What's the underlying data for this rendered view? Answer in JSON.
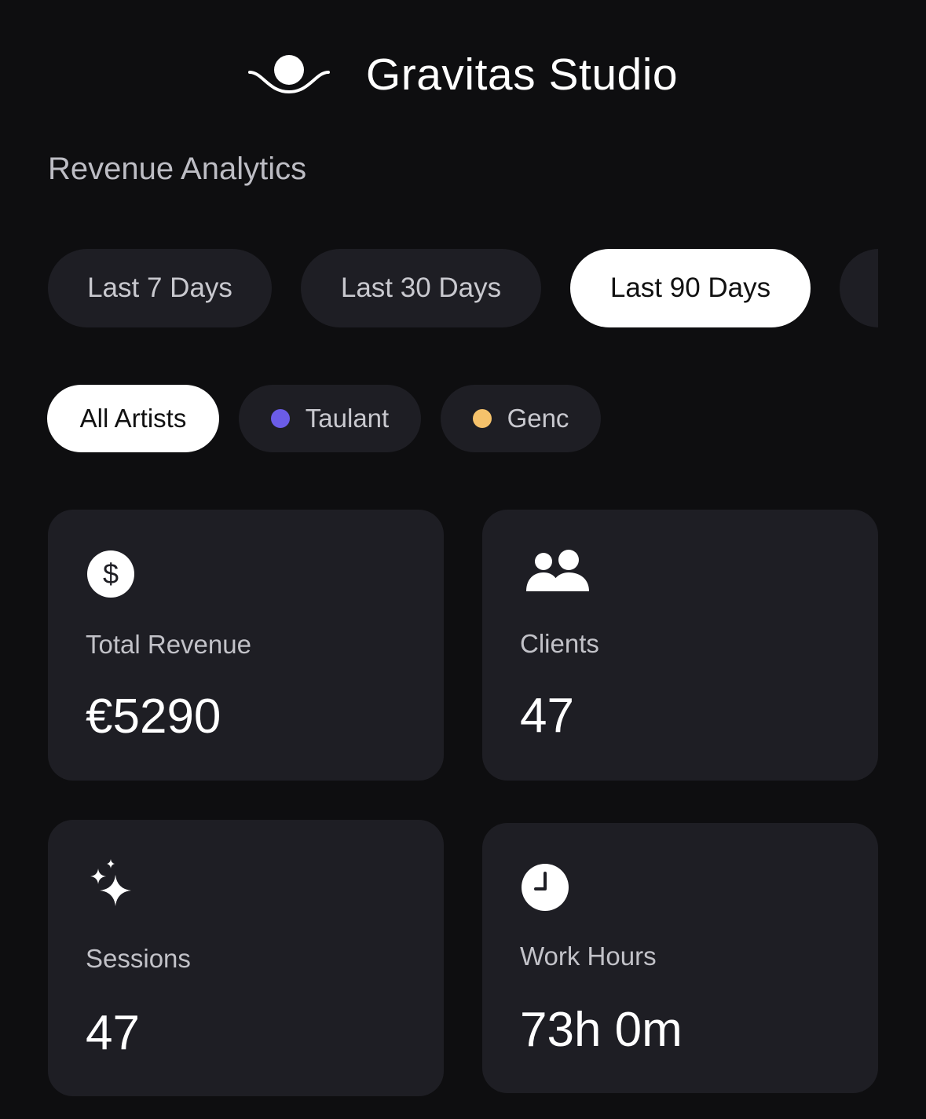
{
  "header": {
    "app_title": "Gravitas Studio",
    "logo_icon": "gravitas-logo-icon"
  },
  "section": {
    "title": "Revenue Analytics"
  },
  "period_tabs": [
    {
      "label": "Last 7 Days",
      "active": false
    },
    {
      "label": "Last 30 Days",
      "active": false
    },
    {
      "label": "Last 90 Days",
      "active": true
    },
    {
      "label": "",
      "active": false
    }
  ],
  "artist_filters": [
    {
      "label": "All Artists",
      "active": true,
      "dot_color": ""
    },
    {
      "label": "Taulant",
      "active": false,
      "dot_color": "#6b5ce7"
    },
    {
      "label": "Genc",
      "active": false,
      "dot_color": "#f5c26b"
    }
  ],
  "stats": {
    "revenue": {
      "label": "Total Revenue",
      "value": "€5290",
      "icon": "dollar-icon"
    },
    "clients": {
      "label": "Clients",
      "value": "47",
      "icon": "users-icon"
    },
    "sessions": {
      "label": "Sessions",
      "value": "47",
      "icon": "sparkles-icon"
    },
    "work_hours": {
      "label": "Work Hours",
      "value": "73h 0m",
      "icon": "clock-icon"
    }
  },
  "colors": {
    "background": "#0e0e10",
    "card": "#1e1e24",
    "active_pill": "#ffffff",
    "taulant": "#6b5ce7",
    "genc": "#f5c26b"
  }
}
